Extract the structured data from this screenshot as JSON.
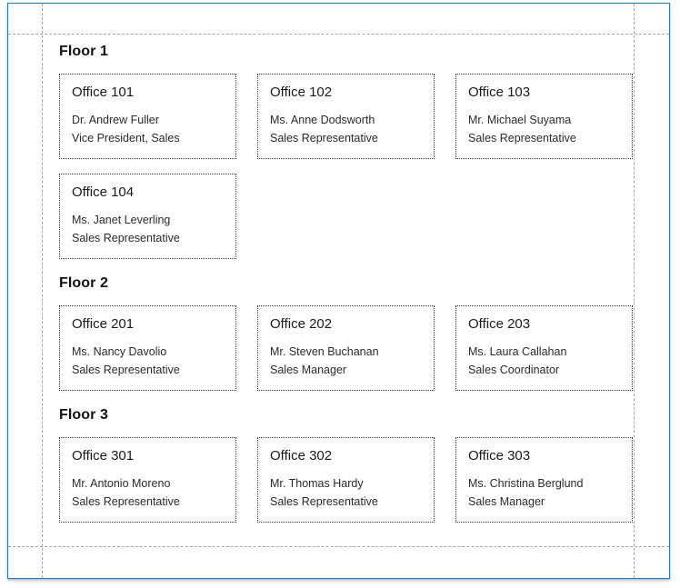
{
  "window": {
    "border_color": "#2a7ab9",
    "background": "#ffffff"
  },
  "guides": {
    "color": "#a6a6a6",
    "style": "dashed"
  },
  "card_style": {
    "border_color": "#333333",
    "border_style": "dotted"
  },
  "floors": [
    {
      "title": "Floor 1",
      "offices": [
        {
          "name": "Office 101",
          "person": "Dr. Andrew Fuller",
          "role": "Vice President, Sales"
        },
        {
          "name": "Office 102",
          "person": "Ms. Anne Dodsworth",
          "role": "Sales Representative"
        },
        {
          "name": "Office 103",
          "person": "Mr. Michael Suyama",
          "role": "Sales Representative"
        },
        {
          "name": "Office 104",
          "person": "Ms. Janet Leverling",
          "role": "Sales Representative"
        }
      ]
    },
    {
      "title": "Floor 2",
      "offices": [
        {
          "name": "Office 201",
          "person": "Ms. Nancy Davolio",
          "role": "Sales Representative"
        },
        {
          "name": "Office 202",
          "person": "Mr. Steven Buchanan",
          "role": "Sales Manager"
        },
        {
          "name": "Office 203",
          "person": "Ms. Laura Callahan",
          "role": "Sales Coordinator"
        }
      ]
    },
    {
      "title": "Floor 3",
      "offices": [
        {
          "name": "Office 301",
          "person": "Mr. Antonio Moreno",
          "role": "Sales Representative"
        },
        {
          "name": "Office 302",
          "person": "Mr. Thomas Hardy",
          "role": "Sales Representative"
        },
        {
          "name": "Office 303",
          "person": "Ms. Christina Berglund",
          "role": "Sales Manager"
        }
      ]
    }
  ]
}
